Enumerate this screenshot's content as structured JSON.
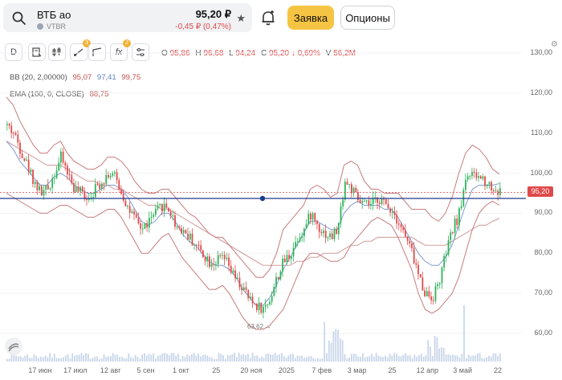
{
  "ticker": {
    "name": "ВТБ ао",
    "code": "VTBR",
    "price": "95,20 ₽",
    "change": "-0,45 ₽ (0,47%)"
  },
  "actions": {
    "order_label": "Заявка",
    "options_label": "Опционы"
  },
  "toolbar": {
    "interval_label": "D",
    "drawing_badge": "3",
    "indicators_badge": "2",
    "indicators_label": "fx"
  },
  "ohlc": {
    "o_key": "O",
    "o": "95,86",
    "h_key": "H",
    "h": "96,68",
    "l_key": "L",
    "l": "94,24",
    "c_key": "C",
    "c": "95,20",
    "change": "↓ 0,69%",
    "v_key": "V",
    "v": "56,2M"
  },
  "indicators": [
    {
      "label": "BB",
      "params": "(20, 2,00000)",
      "values": [
        "95,07",
        "97,41",
        "99,75"
      ]
    },
    {
      "label": "EMA",
      "params": "(100, 0, CLOSE)",
      "values": [
        "88,75"
      ]
    }
  ],
  "price_tag": "95,20",
  "min_label": "63,62 →",
  "colors": {
    "accent": "#f6c443",
    "down": "#e04a4a",
    "up": "#2fb35a",
    "bb": "#c77c7c",
    "ema": "#d6a9a9",
    "mid": "#7f9bd0",
    "hline": "#1e3a8a"
  },
  "chart_data": {
    "type": "candlestick",
    "y_ticks": [
      "130,00",
      "120,00",
      "110,00",
      "100,00",
      "90,00",
      "80,00",
      "70,00",
      "60,00"
    ],
    "x_ticks": [
      "17 июн",
      "17 июл",
      "12 авг",
      "5 сен",
      "1 окт",
      "25",
      "20 ноя",
      "2025",
      "7 фев",
      "3 мар",
      "25",
      "12 апр",
      "3 май",
      "22"
    ],
    "ylim": [
      57,
      132
    ],
    "close_path": [
      112,
      110,
      106,
      102,
      98,
      95,
      96,
      100,
      104,
      100,
      96,
      95,
      94,
      96,
      98,
      100,
      99,
      95,
      91,
      88,
      86,
      88,
      90,
      92,
      91,
      87,
      86,
      84,
      82,
      80,
      78,
      78,
      79,
      76,
      73,
      71,
      68,
      67,
      66,
      69,
      74,
      78,
      80,
      84,
      86,
      90,
      87,
      85,
      84,
      86,
      98,
      96,
      93,
      92,
      92,
      94,
      92,
      91,
      88,
      84,
      80,
      74,
      70,
      69,
      73,
      80,
      86,
      90,
      100,
      99,
      99,
      98,
      96,
      95.2
    ],
    "bb_upper": [
      119,
      117,
      113,
      110,
      107,
      105,
      105,
      107,
      108,
      105,
      103,
      102,
      101,
      101,
      102,
      104,
      104,
      103,
      101,
      98,
      96,
      95,
      95,
      96,
      96,
      94,
      92,
      90,
      89,
      87,
      85,
      84,
      84,
      82,
      80,
      78,
      76,
      74,
      74,
      76,
      80,
      86,
      88,
      90,
      92,
      96,
      97,
      96,
      94,
      95,
      102,
      103,
      102,
      98,
      96,
      96,
      95,
      95,
      95,
      93,
      91,
      91,
      91,
      89,
      88,
      90,
      94,
      100,
      105,
      107,
      106,
      104,
      101,
      99.75
    ],
    "bb_lower": [
      95,
      94,
      93,
      92,
      91,
      90,
      90,
      91,
      92,
      92,
      91,
      90,
      89,
      89,
      90,
      91,
      91,
      89,
      86,
      83,
      80,
      80,
      82,
      84,
      85,
      82,
      79,
      77,
      75,
      73,
      71,
      71,
      72,
      70,
      67,
      64,
      62,
      61,
      61,
      62,
      64,
      66,
      70,
      74,
      78,
      80,
      80,
      79,
      78,
      78,
      79,
      82,
      84,
      86,
      88,
      89,
      88,
      87,
      84,
      80,
      76,
      70,
      66,
      65,
      66,
      68,
      70,
      74,
      80,
      86,
      90,
      92,
      93,
      92
    ],
    "bb_mid": [
      108,
      106,
      103,
      101,
      99,
      97,
      97,
      99,
      100,
      99,
      97,
      96,
      95,
      95,
      96,
      97,
      97,
      96,
      94,
      91,
      88,
      87,
      88,
      90,
      90,
      88,
      85,
      83,
      82,
      80,
      78,
      77,
      77,
      76,
      74,
      71,
      69,
      67,
      67,
      69,
      72,
      76,
      79,
      82,
      85,
      88,
      88,
      87,
      86,
      86,
      90,
      92,
      93,
      92,
      92,
      92,
      91,
      91,
      89,
      86,
      83,
      80,
      78,
      77,
      77,
      79,
      82,
      87,
      92,
      96,
      97,
      97,
      97,
      97.41
    ],
    "ema": [
      108,
      107,
      106,
      105,
      104,
      103,
      102,
      102,
      102,
      101,
      100,
      99,
      98,
      98,
      97,
      97,
      96,
      96,
      95,
      94,
      93,
      92,
      92,
      91,
      91,
      90,
      89,
      88,
      87,
      86,
      85,
      84,
      83,
      82,
      81,
      80,
      79,
      78,
      77,
      77,
      77,
      77,
      77,
      78,
      78,
      79,
      79,
      80,
      80,
      80,
      81,
      82,
      82,
      83,
      83,
      84,
      84,
      84,
      84,
      84,
      84,
      83,
      82,
      82,
      82,
      82,
      83,
      84,
      85,
      86,
      87,
      87,
      88,
      88.75
    ],
    "last_close": 95.2,
    "min_low": 63.62,
    "h_line": 93.7
  }
}
